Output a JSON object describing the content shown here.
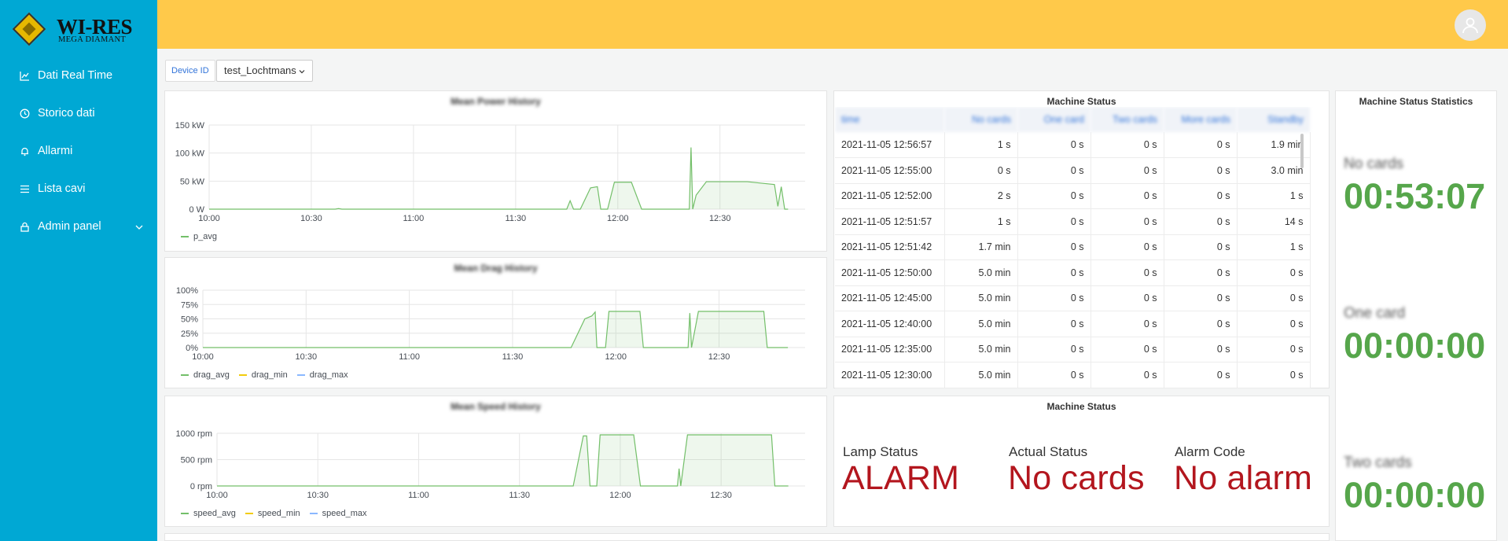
{
  "brand": {
    "title": "WI-RES",
    "subtitle": "MEGA DIAMANT"
  },
  "sidebar": {
    "items": [
      {
        "label": "Dati Real Time",
        "icon": "line-chart-icon"
      },
      {
        "label": "Storico dati",
        "icon": "history-icon"
      },
      {
        "label": "Allarmi",
        "icon": "bell-icon"
      },
      {
        "label": "Lista cavi",
        "icon": "list-icon"
      },
      {
        "label": "Admin panel",
        "icon": "lock-icon"
      }
    ]
  },
  "colors": {
    "sidebar": "#00a8d4",
    "header": "#ffc94a",
    "series_green": "#73bf69",
    "alarm_red": "#b3161e",
    "stat_green": "#56a64b",
    "link_blue": "#3274d9"
  },
  "device": {
    "label": "Device ID",
    "value": "test_Lochtmans"
  },
  "panels": {
    "power": {
      "title": "Mean Power History",
      "legend": [
        "p_avg"
      ]
    },
    "drag": {
      "title": "Mean Drag History",
      "legend": [
        "drag_avg",
        "drag_min",
        "drag_max"
      ]
    },
    "speed": {
      "title": "Mean Speed History",
      "legend": [
        "speed_avg",
        "speed_min",
        "speed_max"
      ]
    },
    "machine_table": {
      "title": "Machine Status"
    },
    "machine_status": {
      "title": "Machine Status",
      "lamp_label": "Lamp Status",
      "lamp_value": "ALARM",
      "actual_label": "Actual Status",
      "actual_value": "No cards",
      "alarm_label": "Alarm Code",
      "alarm_value": "No alarm"
    },
    "stats": {
      "title": "Machine Status Statistics",
      "items": [
        {
          "label": "No cards",
          "value": "00:53:07"
        },
        {
          "label": "One card",
          "value": "00:00:00"
        },
        {
          "label": "Two cards",
          "value": "00:00:00"
        }
      ]
    }
  },
  "table": {
    "columns": [
      "time",
      "No cards",
      "One card",
      "Two cards",
      "More cards",
      "Standby"
    ],
    "rows": [
      [
        "2021-11-05 12:56:57",
        "1 s",
        "0 s",
        "0 s",
        "0 s",
        "1.9 min"
      ],
      [
        "2021-11-05 12:55:00",
        "0 s",
        "0 s",
        "0 s",
        "0 s",
        "3.0 min"
      ],
      [
        "2021-11-05 12:52:00",
        "2 s",
        "0 s",
        "0 s",
        "0 s",
        "1 s"
      ],
      [
        "2021-11-05 12:51:57",
        "1 s",
        "0 s",
        "0 s",
        "0 s",
        "14 s"
      ],
      [
        "2021-11-05 12:51:42",
        "1.7 min",
        "0 s",
        "0 s",
        "0 s",
        "1 s"
      ],
      [
        "2021-11-05 12:50:00",
        "5.0 min",
        "0 s",
        "0 s",
        "0 s",
        "0 s"
      ],
      [
        "2021-11-05 12:45:00",
        "5.0 min",
        "0 s",
        "0 s",
        "0 s",
        "0 s"
      ],
      [
        "2021-11-05 12:40:00",
        "5.0 min",
        "0 s",
        "0 s",
        "0 s",
        "0 s"
      ],
      [
        "2021-11-05 12:35:00",
        "5.0 min",
        "0 s",
        "0 s",
        "0 s",
        "0 s"
      ],
      [
        "2021-11-05 12:30:00",
        "5.0 min",
        "0 s",
        "0 s",
        "0 s",
        "0 s"
      ]
    ]
  },
  "chart_data": [
    {
      "type": "area",
      "title": "Mean Power History",
      "x_ticks": [
        "10:00",
        "10:30",
        "11:00",
        "11:30",
        "12:00",
        "12:30"
      ],
      "y_ticks": [
        "0 W",
        "50 kW",
        "100 kW",
        "150 kW"
      ],
      "ylim": [
        0,
        150
      ],
      "series": [
        {
          "name": "p_avg",
          "points": [
            [
              0,
              0
            ],
            [
              37,
              0
            ],
            [
              38,
              1
            ],
            [
              39,
              0
            ],
            [
              105,
              0
            ],
            [
              106,
              15
            ],
            [
              107,
              0
            ],
            [
              109,
              0
            ],
            [
              112,
              38
            ],
            [
              114,
              40
            ],
            [
              115,
              0
            ],
            [
              117,
              0
            ],
            [
              119,
              48
            ],
            [
              124,
              48
            ],
            [
              127,
              0
            ],
            [
              141,
              0
            ],
            [
              141.5,
              110
            ],
            [
              142,
              0
            ],
            [
              143,
              25
            ],
            [
              146,
              49
            ],
            [
              158,
              49
            ],
            [
              166,
              44
            ],
            [
              167,
              5
            ],
            [
              168,
              40
            ],
            [
              169,
              0
            ],
            [
              170,
              0
            ]
          ]
        }
      ]
    },
    {
      "type": "area",
      "title": "Mean Drag History",
      "x_ticks": [
        "10:00",
        "10:30",
        "11:00",
        "11:30",
        "12:00",
        "12:30"
      ],
      "y_ticks": [
        "0%",
        "25%",
        "50%",
        "75%",
        "100%"
      ],
      "ylim": [
        0,
        100
      ],
      "series": [
        {
          "name": "drag_avg",
          "points": [
            [
              0,
              0
            ],
            [
              107,
              0
            ],
            [
              111,
              50
            ],
            [
              113,
              55
            ],
            [
              114,
              62
            ],
            [
              114.5,
              0
            ],
            [
              117,
              0
            ],
            [
              118,
              63
            ],
            [
              127,
              63
            ],
            [
              128,
              0
            ],
            [
              141,
              0
            ],
            [
              141.5,
              60
            ],
            [
              142,
              0
            ],
            [
              144,
              63
            ],
            [
              163,
              63
            ],
            [
              164,
              0
            ],
            [
              170,
              0
            ]
          ]
        },
        {
          "name": "drag_min",
          "points": []
        },
        {
          "name": "drag_max",
          "points": []
        }
      ]
    },
    {
      "type": "area",
      "title": "Mean Speed History",
      "x_ticks": [
        "10:00",
        "10:30",
        "11:00",
        "11:30",
        "12:00",
        "12:30"
      ],
      "y_ticks": [
        "0 rpm",
        "500 rpm",
        "1000 rpm"
      ],
      "ylim": [
        0,
        1000
      ],
      "series": [
        {
          "name": "speed_avg",
          "points": [
            [
              0,
              0
            ],
            [
              106,
              0
            ],
            [
              109,
              950
            ],
            [
              110,
              950
            ],
            [
              111,
              0
            ],
            [
              113,
              0
            ],
            [
              114,
              970
            ],
            [
              124,
              970
            ],
            [
              126,
              0
            ],
            [
              137,
              0
            ],
            [
              137.5,
              330
            ],
            [
              138,
              0
            ],
            [
              140,
              970
            ],
            [
              165,
              970
            ],
            [
              166,
              0
            ],
            [
              170,
              0
            ]
          ]
        },
        {
          "name": "speed_min",
          "points": []
        },
        {
          "name": "speed_max",
          "points": []
        }
      ]
    }
  ]
}
